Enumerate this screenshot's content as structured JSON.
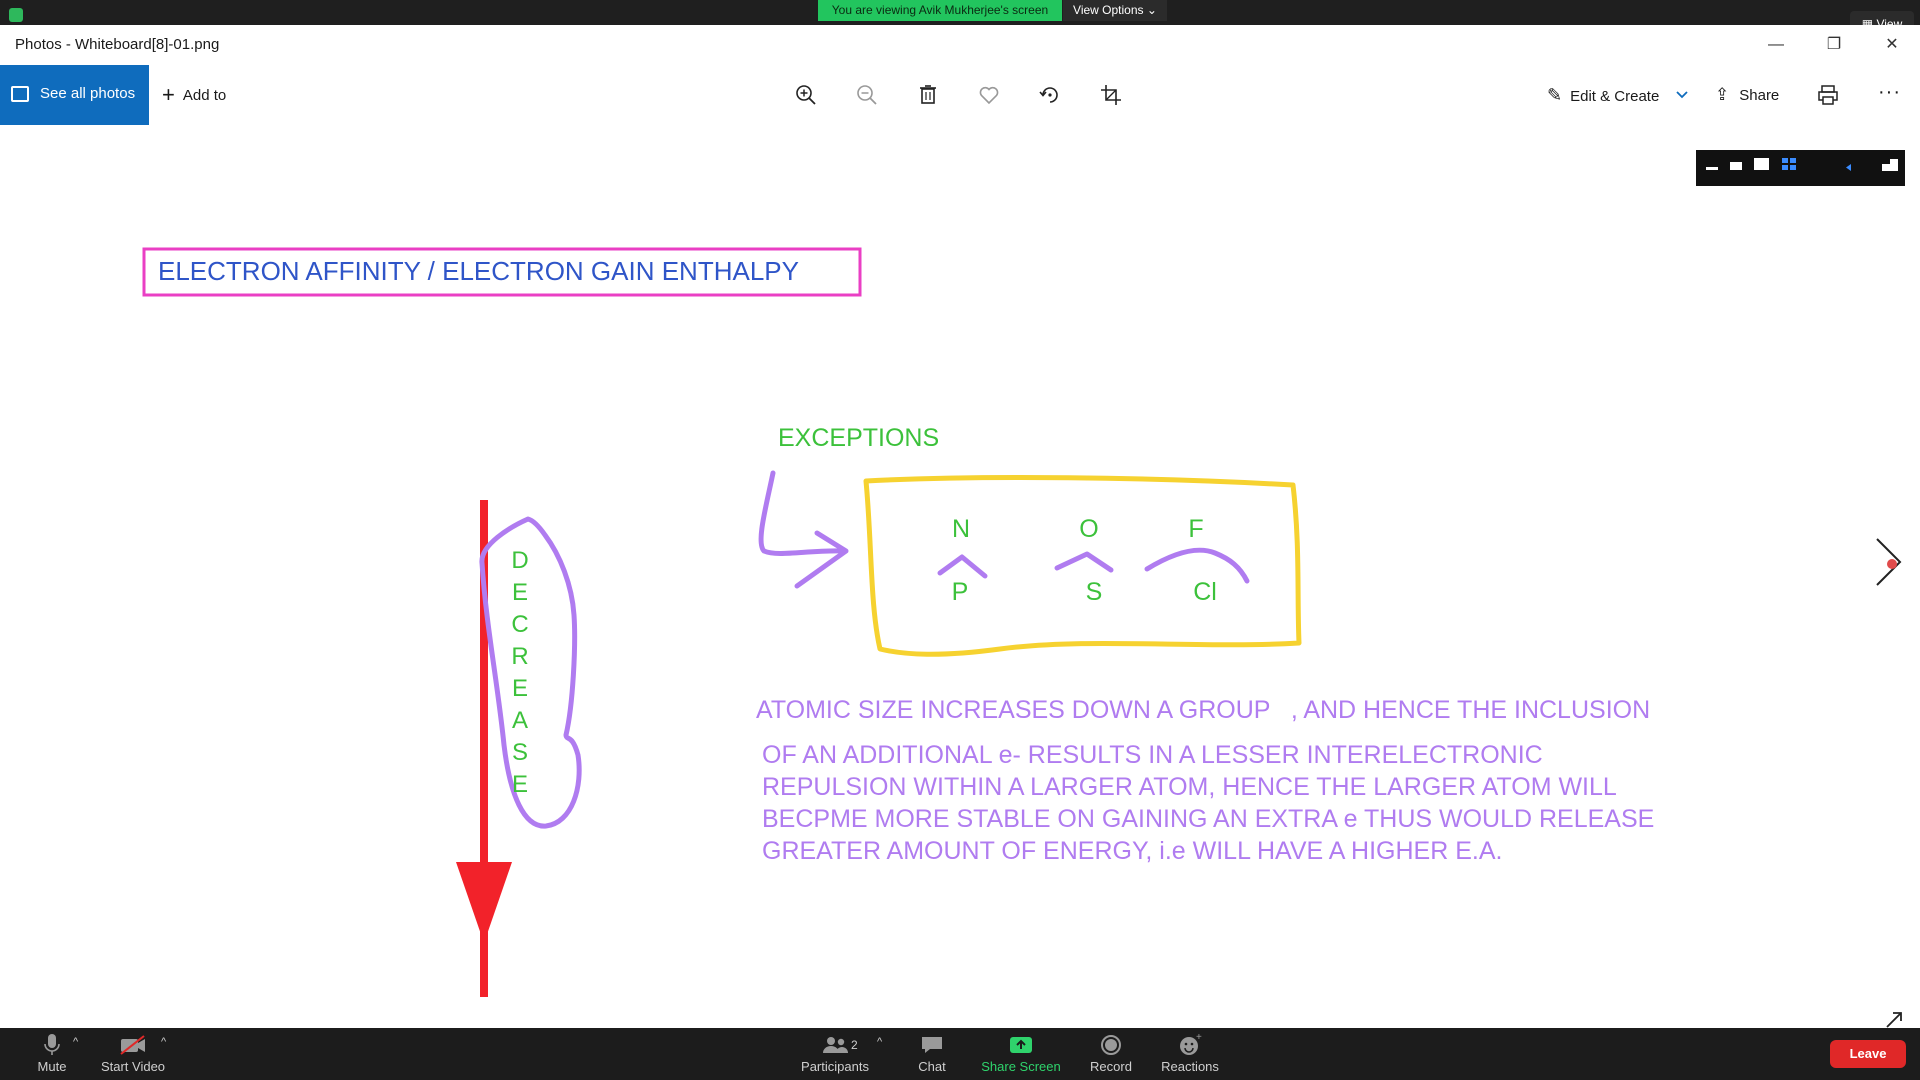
{
  "zoom": {
    "viewing_banner": "You are viewing Avik Mukherjee's screen",
    "view_options_label": "View Options",
    "view_label": "View",
    "bottom_bar": {
      "mute_label": "Mute",
      "start_video_label": "Start Video",
      "participants_label": "Participants",
      "participants_count": "2",
      "chat_label": "Chat",
      "share_screen_label": "Share Screen",
      "record_label": "Record",
      "reactions_label": "Reactions",
      "leave_label": "Leave"
    },
    "colors": {
      "bar": "#1c1c1c",
      "share_green": "#2fd36c",
      "leave_red": "#e02828",
      "banner_green": "#22c55e"
    }
  },
  "window": {
    "title": "Photos - Whiteboard[8]-01.png",
    "controls": [
      "minimize-icon",
      "restore-icon",
      "close-icon"
    ]
  },
  "photos_toolbar": {
    "see_all_photos_label": "See all photos",
    "add_to_label": "Add to",
    "edit_create_label": "Edit & Create",
    "share_label": "Share",
    "icons": [
      "zoom-in-icon",
      "zoom-out-icon",
      "delete-icon",
      "favorite-icon",
      "rotate-icon",
      "crop-icon",
      "print-icon",
      "more-icon"
    ],
    "accent": "#0f6cbd"
  },
  "whiteboard": {
    "title": "ELECTRON AFFINITY / ELECTRON GAIN ENTHALPY",
    "exceptions_label": "EXCEPTIONS",
    "pairs": [
      {
        "top": "N",
        "bottom": "P"
      },
      {
        "top": "O",
        "bottom": "S"
      },
      {
        "top": "F",
        "bottom": "Cl"
      }
    ],
    "decrease_letters": [
      "D",
      "E",
      "C",
      "R",
      "E",
      "A",
      "S",
      "E"
    ],
    "explanation_lines": [
      "ATOMIC SIZE INCREASES DOWN A GROUP   , AND HENCE THE INCLUSION",
      "OF AN ADDITIONAL e- RESULTS IN A LESSER INTERELECTRONIC",
      "REPULSION WITHIN A LARGER ATOM, HENCE THE LARGER ATOM WILL",
      "BECPME MORE STABLE ON GAINING AN EXTRA e THUS WOULD RELEASE",
      "GREATER AMOUNT OF ENERGY, i.e WILL HAVE A HIGHER E.A."
    ],
    "colors": {
      "title_text": "#2f55c8",
      "title_box": "#ea3fc4",
      "green_text": "#3cc13b",
      "purple": "#b07cf0",
      "yellow_box": "#f6d230",
      "red_arrow": "#f2222a"
    }
  }
}
